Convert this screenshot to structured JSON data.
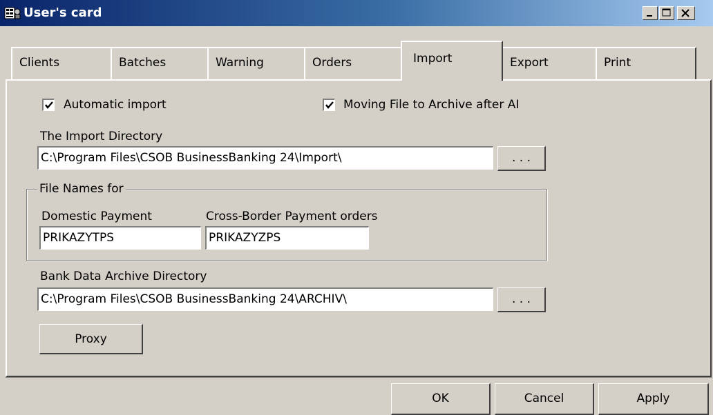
{
  "window": {
    "title": "User's card",
    "controls": {
      "minimize": "minimize-icon",
      "maximize": "maximize-icon",
      "close": "close-icon"
    }
  },
  "tabs": [
    {
      "label": "Clients",
      "active": false
    },
    {
      "label": "Batches",
      "active": false
    },
    {
      "label": "Warning",
      "active": false
    },
    {
      "label": "Orders",
      "active": false
    },
    {
      "label": "Import",
      "active": true
    },
    {
      "label": "Export",
      "active": false
    },
    {
      "label": "Print",
      "active": false
    }
  ],
  "import": {
    "automatic_import_label": "Automatic import",
    "automatic_import_checked": true,
    "moving_file_label": "Moving File to Archive after AI",
    "moving_file_checked": true,
    "import_dir_label": "The Import Directory",
    "import_dir_value": "C:\\Program Files\\CSOB BusinessBanking 24\\Import\\",
    "browse_label": ". . .",
    "file_names_group": "File Names for",
    "domestic_label": "Domestic Payment",
    "domestic_value": "PRIKAZYTPS",
    "crossborder_label": "Cross-Border Payment orders",
    "crossborder_value": "PRIKAZYZPS",
    "archive_dir_label": "Bank Data Archive Directory",
    "archive_dir_value": "C:\\Program Files\\CSOB BusinessBanking 24\\ARCHIV\\",
    "proxy_label": "Proxy"
  },
  "buttons": {
    "ok": "OK",
    "cancel": "Cancel",
    "apply": "Apply"
  }
}
